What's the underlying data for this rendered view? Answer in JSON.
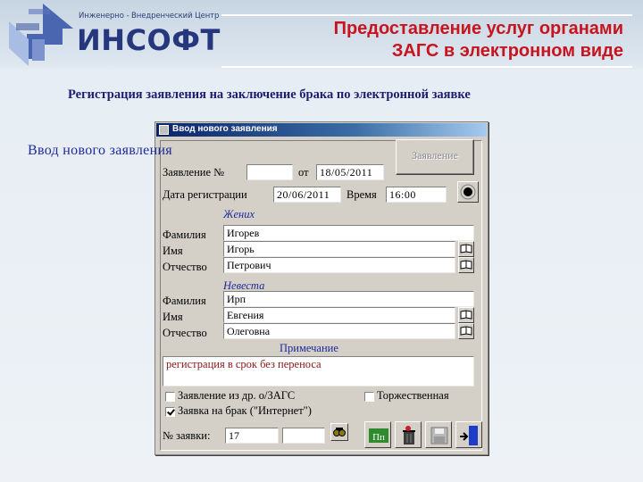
{
  "header": {
    "logo_subtitle": "Инженерно - Внедренческий Центр",
    "logo_name": "ИНСОФТ",
    "title_line1": "Предоставление услуг органами",
    "title_line2": "ЗАГС в электронном виде"
  },
  "subtitle": "Регистрация заявления на заключение брака по электронной заявке",
  "window": {
    "title": "Ввод нового заявления",
    "form_heading": "Ввод нового заявления",
    "statement_button": "Заявление",
    "fields": {
      "statement_no_label": "Заявление №",
      "statement_no_value": "",
      "from_label": "от",
      "from_value": "18/05/2011",
      "reg_date_label": "Дата регистрации",
      "reg_date_value": "20/06/2011",
      "time_label": "Время",
      "time_value": "16:00"
    },
    "groom": {
      "section": "Жених",
      "surname_label": "Фамилия",
      "surname": "Игорев",
      "name_label": "Имя",
      "name": "Игорь",
      "patronymic_label": "Отчество",
      "patronymic": "Петрович"
    },
    "bride": {
      "section": "Невеста",
      "surname_label": "Фамилия",
      "surname": "Ирп",
      "name_label": "Имя",
      "name": "Евгения",
      "patronymic_label": "Отчество",
      "patronymic": "Олеговна"
    },
    "note": {
      "label": "Примечание",
      "text": "регистрация в срок без переноса"
    },
    "checkboxes": {
      "other_zags_label": "Заявление из др. о/ЗАГС",
      "other_zags_checked": false,
      "solemn_label": "Торжественная",
      "solemn_checked": false,
      "internet_label": "Заявка на брак (\"Интернет\")",
      "internet_checked": true
    },
    "request_no_label": "№ заявки:",
    "request_no_value": "17",
    "request_no_extra": ""
  },
  "icons": [
    "logo-arrow-icon",
    "window-app-icon",
    "record-icon",
    "book-icon",
    "binoculars-icon",
    "print-icon",
    "delete-icon",
    "save-icon",
    "exit-door-icon"
  ],
  "colors": {
    "title_red": "#c8141e",
    "form_blue": "#1e2b9b",
    "note_text": "#8a1818",
    "window_face": "#d4d0c8"
  }
}
